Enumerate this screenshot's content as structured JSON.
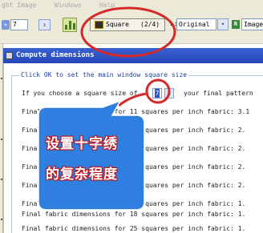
{
  "menubar": {
    "items": [
      "ght Image",
      "Windows",
      "Help"
    ]
  },
  "toolbar": {
    "chevron": "»",
    "number_value": "7",
    "spin_glyph": "⇕",
    "square_label": "Square",
    "square_count": "(2/4)",
    "l_label": "L:",
    "original_value": "Original",
    "dropdown_glyph": "▾",
    "r_label": "R",
    "image_value": "Image"
  },
  "dialog": {
    "title": "Compute dimensions",
    "group_label": "Click OK to set the main window square size",
    "prompt_before": "If you choose a square size of",
    "size_value": "7",
    "prompt_after": "your final pattern",
    "rows": [
      "Final fabric dimensions for 11 squares per inch fabric: 3.1",
      "Final fabric dimensions for 14 squares per inch fabric: 2.",
      "Final fabric dimensions for 16 squares per inch fabric: 2.",
      "Final fabric dimensions for 18 squares per inch fabric: 2.",
      "Final fabric dimensions for 22 squares per inch fabric: 2.",
      "Final fabric dimensions for 25 squares per inch fabric: 1.",
      "Final fabric dimensions for 18 squares per inch fabric: 1.",
      "Final fabric dimensions for 25 squares per inch fabric: 1."
    ]
  },
  "annotation": {
    "line1": "设置十字绣",
    "line2": "的复杂程度",
    "color": "#d42a2a",
    "fill": "#2f7fe0"
  }
}
